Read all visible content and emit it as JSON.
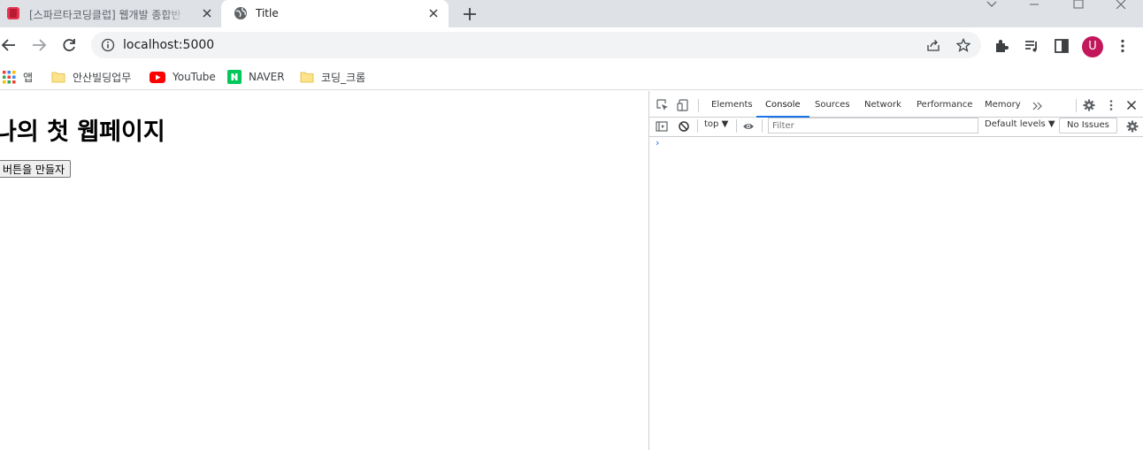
{
  "browser": {
    "tabs": [
      {
        "title": "[스파르타코딩클럽] 웹개발 종합반",
        "active": false
      },
      {
        "title": "Title",
        "active": true
      }
    ],
    "url": "localhost:5000",
    "profile_initial": "U",
    "bookmarks": [
      {
        "label": "앱",
        "icon": "apps-grid-icon"
      },
      {
        "label": "안산빌딩업무",
        "icon": "folder-icon"
      },
      {
        "label": "YouTube",
        "icon": "youtube-icon"
      },
      {
        "label": "NAVER",
        "icon": "naver-icon"
      },
      {
        "label": "코딩_크롬",
        "icon": "folder-icon"
      }
    ]
  },
  "page": {
    "heading": "나의 첫 웹페이지",
    "button_label": "버튼을 만들자"
  },
  "devtools": {
    "tabs": [
      "Elements",
      "Console",
      "Sources",
      "Network",
      "Performance",
      "Memory"
    ],
    "active_tab": "Console",
    "context": "top ▼",
    "filter_placeholder": "Filter",
    "levels": "Default levels ▼",
    "issues": "No Issues",
    "prompt": "›"
  },
  "colors": {
    "accent": "#1a73e8",
    "avatar": "#c2185b",
    "tabstrip": "#dee1e6"
  }
}
